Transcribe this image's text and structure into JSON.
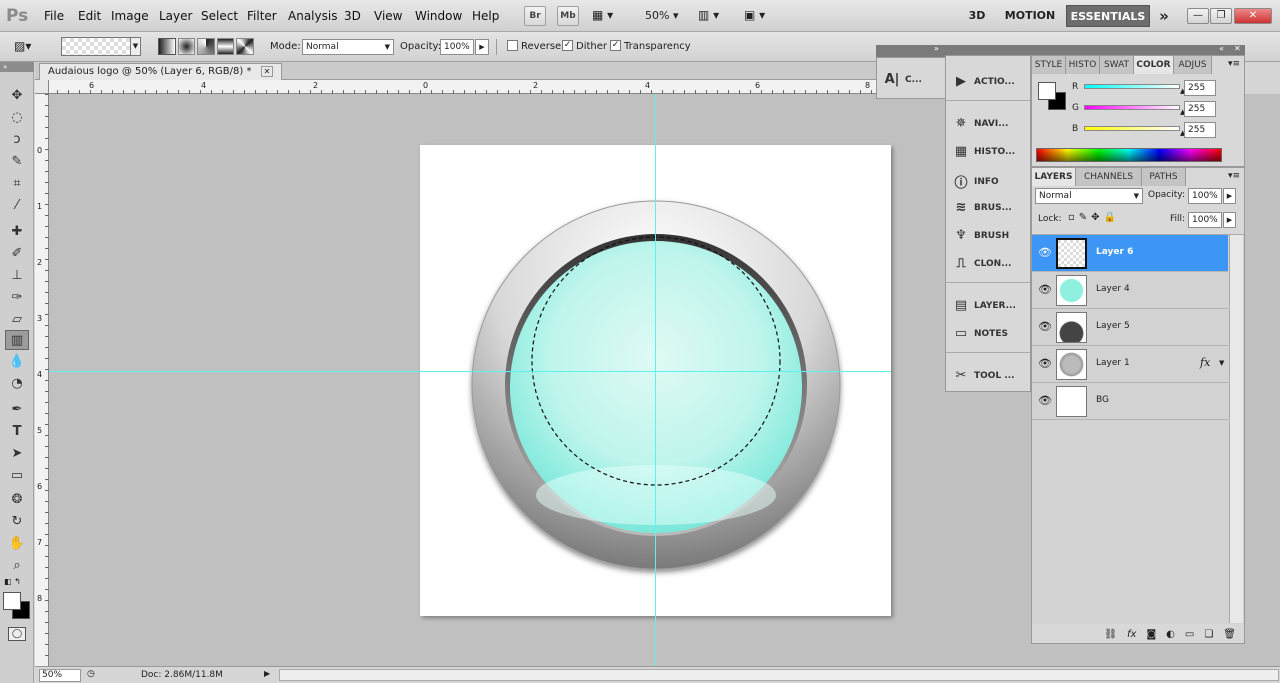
{
  "app": {
    "logo": "Ps"
  },
  "menu": [
    "File",
    "Edit",
    "Image",
    "Layer",
    "Select",
    "Filter",
    "Analysis",
    "3D",
    "View",
    "Window",
    "Help"
  ],
  "menubar_buttons": {
    "bridge": "Br",
    "minibridge": "Mb",
    "zoom": "50%"
  },
  "workspaces": {
    "w3d": "3D",
    "motion": "MOTION",
    "essentials": "ESSENTIALS",
    "more": "»"
  },
  "window_buttons": {
    "min": "—",
    "restore": "❐",
    "close": "✕"
  },
  "options": {
    "mode_label": "Mode:",
    "mode_value": "Normal",
    "opacity_label": "Opacity:",
    "opacity_value": "100%",
    "reverse_label": "Reverse",
    "dither_label": "Dither",
    "transparency_label": "Transparency",
    "reverse_checked": false,
    "dither_checked": true,
    "transparency_checked": true
  },
  "document": {
    "tab_title": "Audaious logo @ 50% (Layer 6, RGB/8) *",
    "close": "✕",
    "ruler_top": [
      "6",
      "4",
      "2",
      "0",
      "2",
      "4",
      "6",
      "8"
    ],
    "ruler_left": [
      "0",
      "1",
      "2",
      "3",
      "4",
      "5",
      "6",
      "7",
      "8"
    ]
  },
  "status": {
    "zoom": "50%",
    "doc": "Doc: 2.86M/11.8M"
  },
  "dock_col1": [
    {
      "icon": "A|",
      "label": "C..."
    }
  ],
  "dock_col2": [
    {
      "icon": "▶",
      "label": "ACTIO..."
    },
    {
      "icon": "✵",
      "label": "NAVI..."
    },
    {
      "icon": "▦",
      "label": "HISTO..."
    },
    {
      "icon": "ⓘ",
      "label": "INFO"
    },
    {
      "icon": "≋",
      "label": "BRUS..."
    },
    {
      "icon": "♆",
      "label": "BRUSH"
    },
    {
      "icon": "⎍",
      "label": "CLON..."
    },
    {
      "icon": "▤",
      "label": "LAYER..."
    },
    {
      "icon": "▭",
      "label": "NOTES"
    },
    {
      "icon": "✂",
      "label": "TOOL ..."
    }
  ],
  "color_panel": {
    "tabs": [
      "STYLE",
      "HISTO",
      "SWAT",
      "COLOR",
      "ADJUS"
    ],
    "r_label": "R",
    "g_label": "G",
    "b_label": "B",
    "r": "255",
    "g": "255",
    "b": "255"
  },
  "layers_panel": {
    "tabs": [
      "LAYERS",
      "CHANNELS",
      "PATHS"
    ],
    "blend": "Normal",
    "opacity_label": "Opacity:",
    "opacity": "100%",
    "lock_label": "Lock:",
    "fill_label": "Fill:",
    "fill": "100%",
    "fx": "fx",
    "layers": [
      {
        "name": "Layer 6",
        "selected": true
      },
      {
        "name": "Layer 4",
        "selected": false
      },
      {
        "name": "Layer 5",
        "selected": false
      },
      {
        "name": "Layer 1",
        "selected": false
      },
      {
        "name": "BG",
        "selected": false
      }
    ],
    "footer_icons": [
      "⛓",
      "fx",
      "◙",
      "◐",
      "▭",
      "❏",
      "🗑"
    ]
  },
  "colors": {
    "selection": "#3d95f5",
    "guide": "#5ff0f0",
    "glass": "#9ff0e6"
  }
}
